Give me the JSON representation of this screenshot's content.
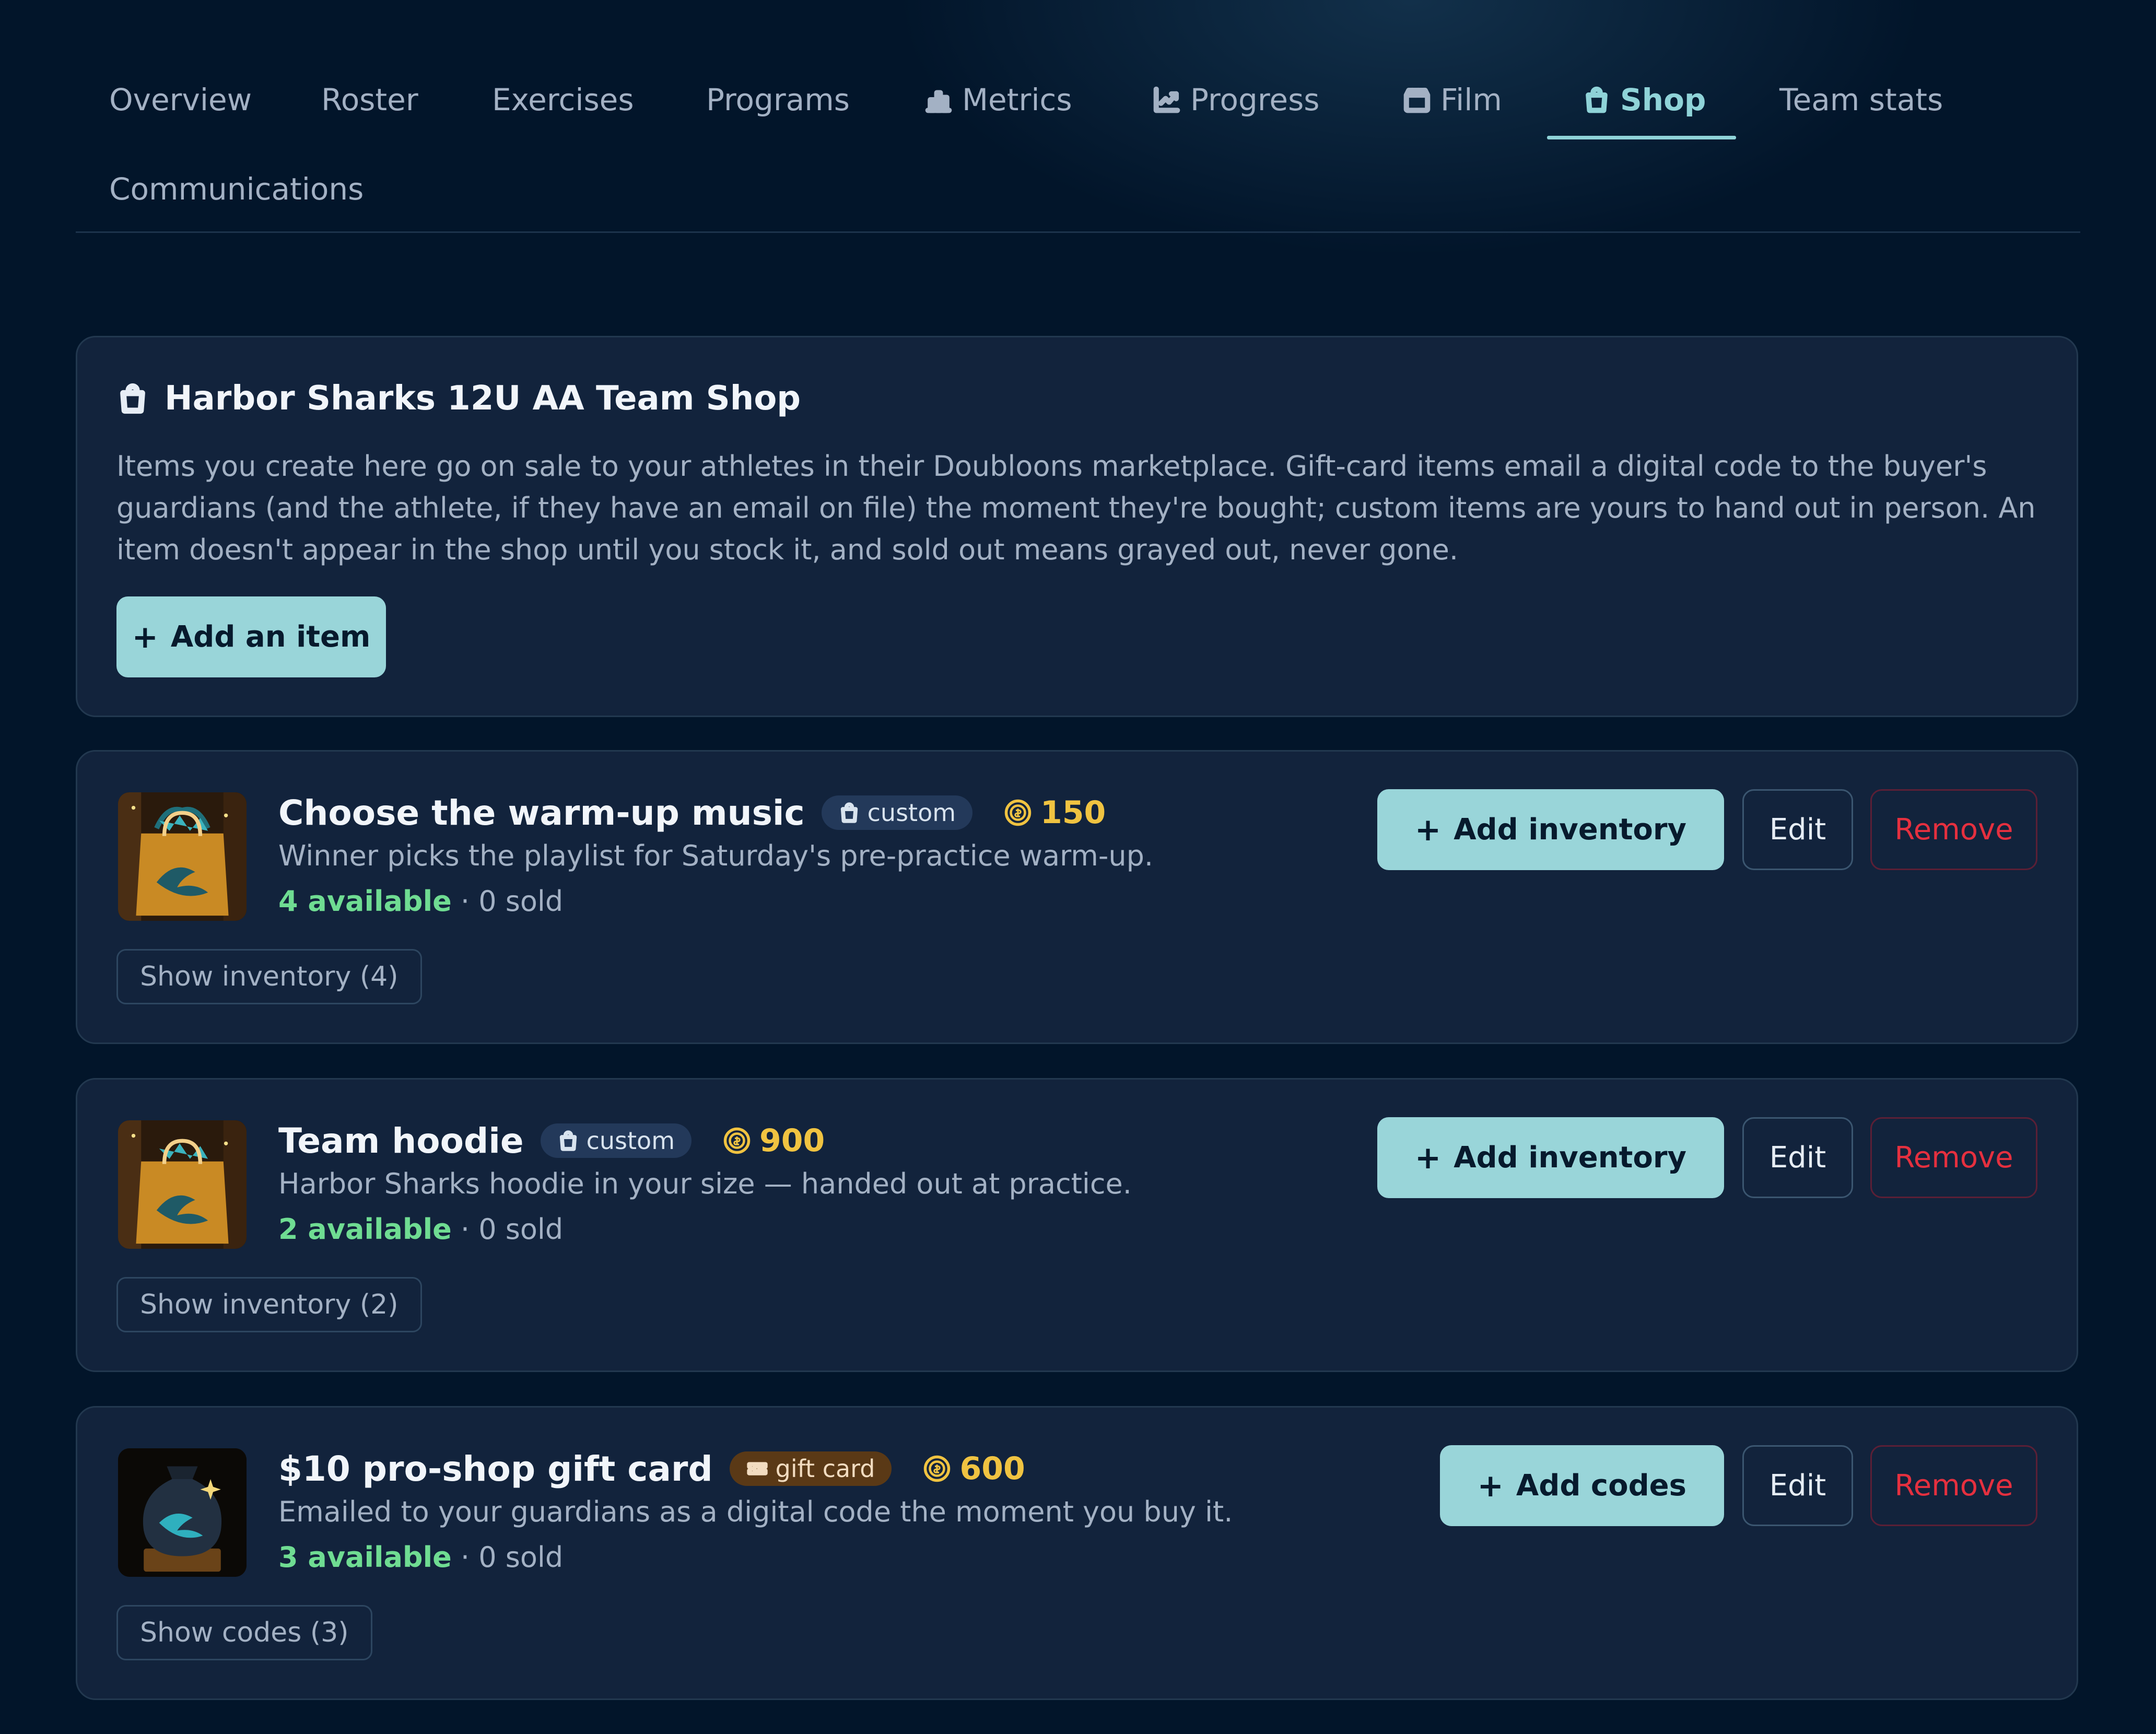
{
  "nav": {
    "tabs": [
      {
        "label": "Overview",
        "icon": null
      },
      {
        "label": "Roster",
        "icon": null
      },
      {
        "label": "Exercises",
        "icon": null
      },
      {
        "label": "Programs",
        "icon": null
      },
      {
        "label": "Metrics",
        "icon": "bar-chart-icon"
      },
      {
        "label": "Progress",
        "icon": "line-chart-icon"
      },
      {
        "label": "Film",
        "icon": "clapperboard-icon"
      },
      {
        "label": "Shop",
        "icon": "shopping-bag-icon",
        "active": true
      },
      {
        "label": "Team stats",
        "icon": null
      },
      {
        "label": "Communications",
        "icon": null
      }
    ]
  },
  "shop": {
    "title": "Harbor Sharks 12U AA Team Shop",
    "title_icon": "shopping-bag-icon",
    "description": "Items you create here go on sale to your athletes in their Doubloons marketplace. Gift-card items email a digital code to the buyer's guardians (and the athlete, if they have an email on file) the moment they're bought; custom items are yours to hand out in person. An item doesn't appear in the shop until you stock it, and sold out means grayed out, never gone.",
    "add_item_label": "Add an item"
  },
  "items": [
    {
      "title": "Choose the warm-up music",
      "badge": "custom",
      "badge_icon": "shopping-bag-icon",
      "price": "150",
      "price_icon": "doubloon-coin-icon",
      "description": "Winner picks the playlist for Saturday's pre-practice warm-up.",
      "available": "4 available",
      "sold": " · 0 sold",
      "show_label": "Show inventory (4)",
      "add_label": "Add inventory",
      "edit_label": "Edit",
      "remove_label": "Remove",
      "image": "shark-shopping-bag"
    },
    {
      "title": "Team hoodie",
      "badge": "custom",
      "badge_icon": "shopping-bag-icon",
      "price": "900",
      "price_icon": "doubloon-coin-icon",
      "description": "Harbor Sharks hoodie in your size — handed out at practice.",
      "available": "2 available",
      "sold": " · 0 sold",
      "show_label": "Show inventory (2)",
      "add_label": "Add inventory",
      "edit_label": "Edit",
      "remove_label": "Remove",
      "image": "shark-shopping-bag"
    },
    {
      "title": "$10 pro-shop gift card",
      "badge": "gift card",
      "badge_icon": "ticket-icon",
      "price": "600",
      "price_icon": "doubloon-coin-icon",
      "description": "Emailed to your guardians as a digital code the moment you buy it.",
      "available": "3 available",
      "sold": " · 0 sold",
      "show_label": "Show codes (3)",
      "add_label": "Add codes",
      "edit_label": "Edit",
      "remove_label": "Remove",
      "image": "shark-coin-pouch"
    }
  ],
  "colors": {
    "background": "#02152a",
    "card": "#12233c",
    "accent": "#99d5d9",
    "active_tab": "#8fd3d8",
    "available": "#6fdc92",
    "price": "#f0c341",
    "remove": "#e5303f",
    "gift_badge": "#5a3916"
  }
}
